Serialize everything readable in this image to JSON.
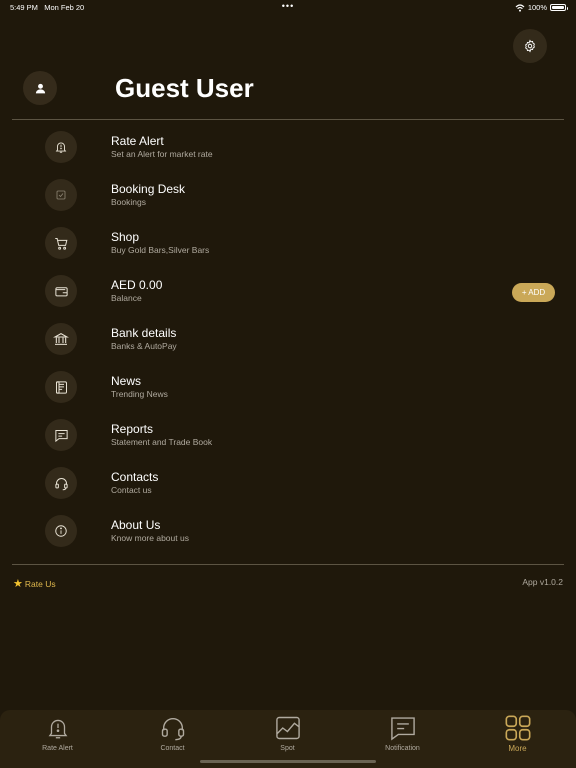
{
  "status_bar": {
    "time": "5:49 PM",
    "date": "Mon Feb 20",
    "dots": "•••",
    "battery": "100%"
  },
  "header": {
    "user_name": "Guest User",
    "settings_icon": "gear-icon",
    "avatar_icon": "person-icon"
  },
  "menu": [
    {
      "title": "Rate Alert",
      "subtitle": "Set an Alert for market rate",
      "icon": "bell-icon"
    },
    {
      "title": "Booking Desk",
      "subtitle": "Bookings",
      "icon": "checkbox-icon"
    },
    {
      "title": "Shop",
      "subtitle": "Buy Gold Bars,Silver Bars",
      "icon": "cart-icon"
    },
    {
      "title": "AED 0.00",
      "subtitle": "Balance",
      "icon": "wallet-icon"
    },
    {
      "title": "Bank details",
      "subtitle": "Banks & AutoPay",
      "icon": "bank-icon"
    },
    {
      "title": "News",
      "subtitle": "Trending News",
      "icon": "newspaper-icon"
    },
    {
      "title": "Reports",
      "subtitle": "Statement and Trade Book",
      "icon": "report-icon"
    },
    {
      "title": "Contacts",
      "subtitle": "Contact us",
      "icon": "headset-icon"
    },
    {
      "title": "About Us",
      "subtitle": "Know more about us",
      "icon": "info-icon"
    }
  ],
  "balance_action": {
    "label": "+ ADD"
  },
  "footer": {
    "rate_us": "Rate Us",
    "version": "App v1.0.2"
  },
  "tabs": [
    {
      "label": "Rate Alert",
      "icon": "bell-icon",
      "active": false
    },
    {
      "label": "Contact",
      "icon": "headset-icon",
      "active": false
    },
    {
      "label": "Spot",
      "icon": "chart-icon",
      "active": false
    },
    {
      "label": "Notification",
      "icon": "message-icon",
      "active": false
    },
    {
      "label": "More",
      "icon": "grid-icon",
      "active": true
    }
  ],
  "colors": {
    "background": "#1f180b",
    "accent": "#caa858",
    "icon_circle": "#332a1a",
    "subtitle": "#b0aa9f"
  }
}
